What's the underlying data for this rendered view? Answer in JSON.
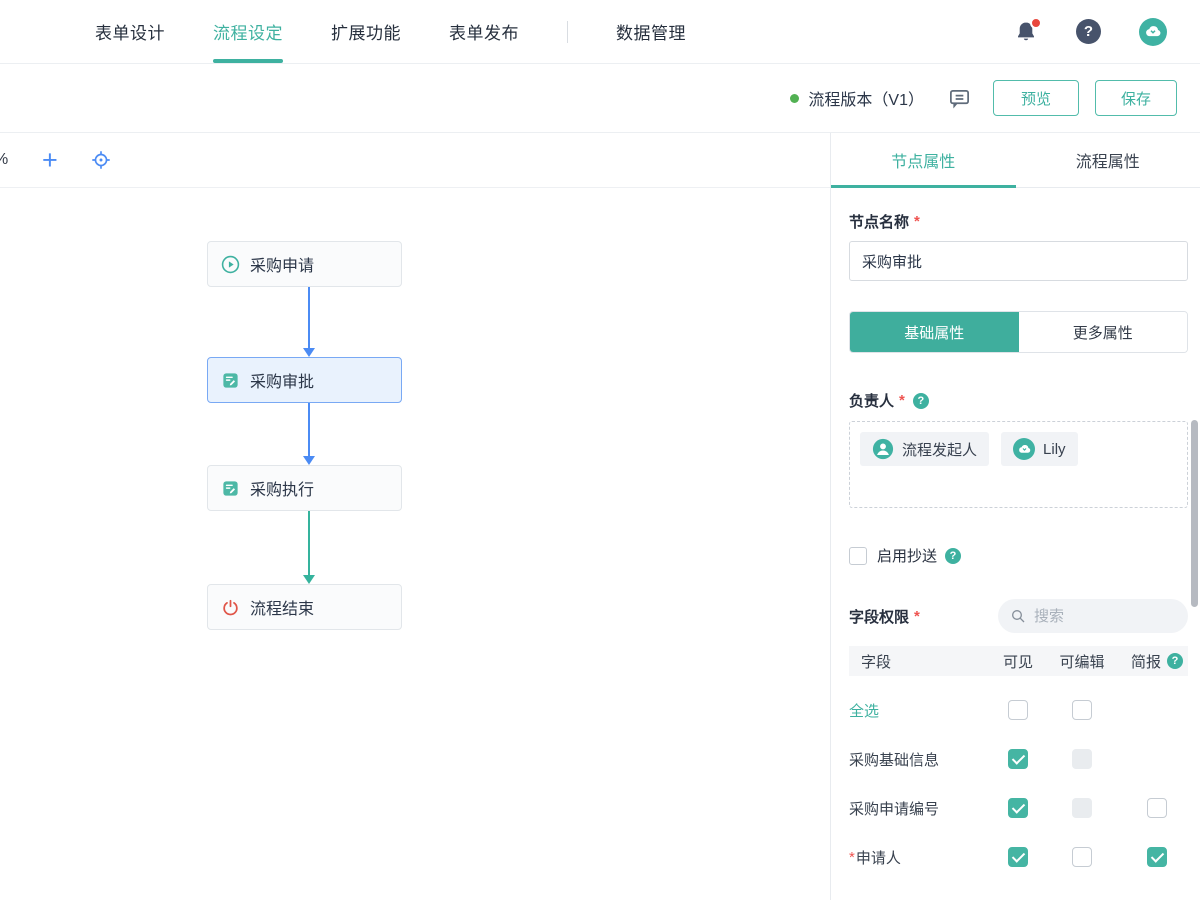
{
  "colors": {
    "teal": "#3eb1a0",
    "blue": "#4b8bf4",
    "red": "#e05548",
    "status_green": "#52b153"
  },
  "topnav": {
    "tabs": [
      {
        "label": "表单设计"
      },
      {
        "label": "流程设定"
      },
      {
        "label": "扩展功能"
      },
      {
        "label": "表单发布"
      },
      {
        "label": "数据管理"
      }
    ]
  },
  "versionbar": {
    "version_label": "流程版本（V1）",
    "preview_label": "预览",
    "save_label": "保存"
  },
  "canvas": {
    "zoom_text": "%",
    "nodes": [
      {
        "label": "采购申请",
        "icon": "play-circle-icon"
      },
      {
        "label": "采购审批",
        "icon": "approval-icon"
      },
      {
        "label": "采购执行",
        "icon": "approval-icon"
      },
      {
        "label": "流程结束",
        "icon": "power-icon"
      }
    ]
  },
  "panel": {
    "tabs": [
      {
        "label": "节点属性"
      },
      {
        "label": "流程属性"
      }
    ],
    "node_name": {
      "label": "节点名称",
      "required": "*",
      "value": "采购审批"
    },
    "prop_tabs": [
      {
        "label": "基础属性"
      },
      {
        "label": "更多属性"
      }
    ],
    "owner": {
      "label": "负责人",
      "required": "*",
      "tags": [
        {
          "label": "流程发起人"
        },
        {
          "label": "Lily"
        }
      ]
    },
    "cc": {
      "label": "启用抄送",
      "state": "unchecked"
    },
    "field_perm": {
      "label": "字段权限",
      "required": "*",
      "search_placeholder": "搜索"
    },
    "field_table": {
      "headers": [
        "字段",
        "可见",
        "可编辑",
        "简报"
      ],
      "rows": [
        {
          "label": "全选",
          "visible": "unchecked",
          "editable": "unchecked",
          "report": "none"
        },
        {
          "label": "采购基础信息",
          "visible": "checked",
          "editable": "disabled",
          "report": "none"
        },
        {
          "label": "采购申请编号",
          "visible": "checked",
          "editable": "disabled",
          "report": "unchecked"
        },
        {
          "label": "申请人",
          "star": "*",
          "visible": "checked",
          "editable": "unchecked",
          "report": "checked"
        }
      ]
    }
  }
}
